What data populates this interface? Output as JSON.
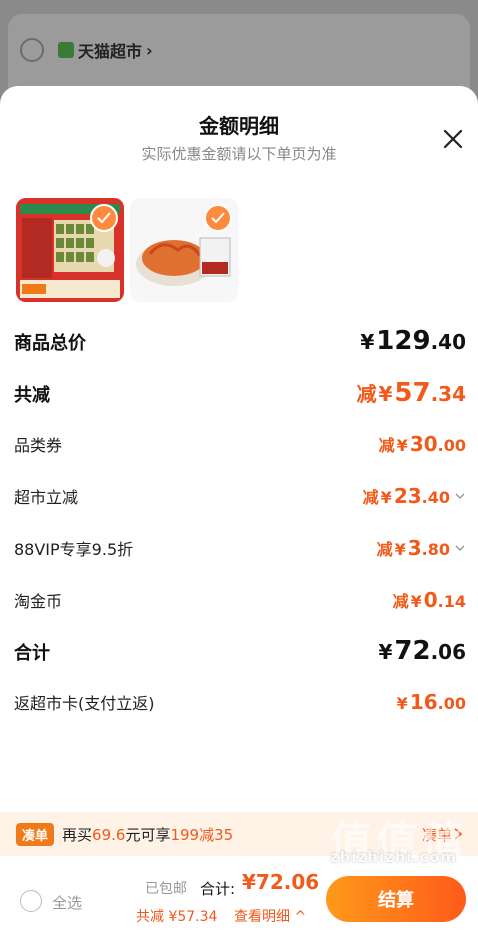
{
  "background": {
    "shop_name": "天猫超市",
    "shop_chevron": "chevron-right-icon"
  },
  "sheet": {
    "title": "金额明细",
    "subtitle": "实际优惠金额请以下单页为准",
    "close_icon": "close-icon"
  },
  "products": [
    {
      "name": "product-thumb-1",
      "checked": true
    },
    {
      "name": "product-thumb-2",
      "checked": true
    }
  ],
  "rows": {
    "subtotal": {
      "label": "商品总价",
      "yen": "¥",
      "int": "129",
      "dec": ".40"
    },
    "total_reduce": {
      "label": "共减",
      "prefix": "减",
      "yen": "¥",
      "int": "57",
      "dec": ".34"
    },
    "coupon": {
      "label": "品类券",
      "prefix": "减",
      "yen": "¥",
      "int": "30",
      "dec": ".00"
    },
    "market_off": {
      "label": "超市立减",
      "prefix": "减",
      "yen": "¥",
      "int": "23",
      "dec": ".40"
    },
    "vip": {
      "label": "88VIP专享9.5折",
      "prefix": "减",
      "yen": "¥",
      "int": "3",
      "dec": ".80"
    },
    "coin": {
      "label": "淘金币",
      "prefix": "减",
      "yen": "¥",
      "int": "0",
      "dec": ".14"
    },
    "total": {
      "label": "合计",
      "yen": "¥",
      "int": "72",
      "dec": ".06"
    },
    "rebate": {
      "label": "返超市卡(支付立返)",
      "yen": "¥",
      "int": "16",
      "dec": ".00"
    }
  },
  "promo": {
    "tag": "凑单",
    "text_a": "再买",
    "amount": "69.6",
    "text_b": "元可享",
    "deal": "199减35",
    "link": "凑单"
  },
  "bottom": {
    "select_all": "全选",
    "shipped": "已包邮",
    "total_label": "合计:",
    "total_value": "¥72.06",
    "reduce_text": "共减 ¥57.34",
    "detail_link": "查看明细",
    "settle_label": "结算"
  },
  "watermark": {
    "text": "zhizhizhi.com",
    "logo": "值值值"
  },
  "colors": {
    "accent": "#f05a1a",
    "check": "#ff8a3d"
  }
}
